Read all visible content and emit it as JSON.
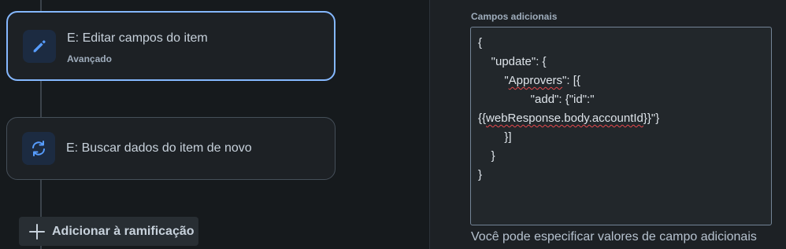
{
  "workflow": {
    "nodes": [
      {
        "title": "E: Editar campos do item",
        "subtitle": "Avançado",
        "icon": "pencil-icon"
      },
      {
        "title": "E: Buscar dados do item de novo",
        "icon": "refresh-icon"
      }
    ],
    "add_branch_label": "Adicionar à ramificação"
  },
  "panel": {
    "field_label": "Campos adicionais",
    "editor_lines": [
      "{",
      "    \"update\": {",
      "        \"Approvers\": [{",
      "                \"add\": {\"id\":\"",
      "{{webResponse.body.accountId}}\"}",
      "        }]",
      "    }",
      "}"
    ],
    "helper_text": "Você pode especificar valores de campo adicionais"
  },
  "colors": {
    "accent_border": "#85b8ff",
    "icon_blue": "#579dff",
    "spell_error": "#e5484d"
  }
}
